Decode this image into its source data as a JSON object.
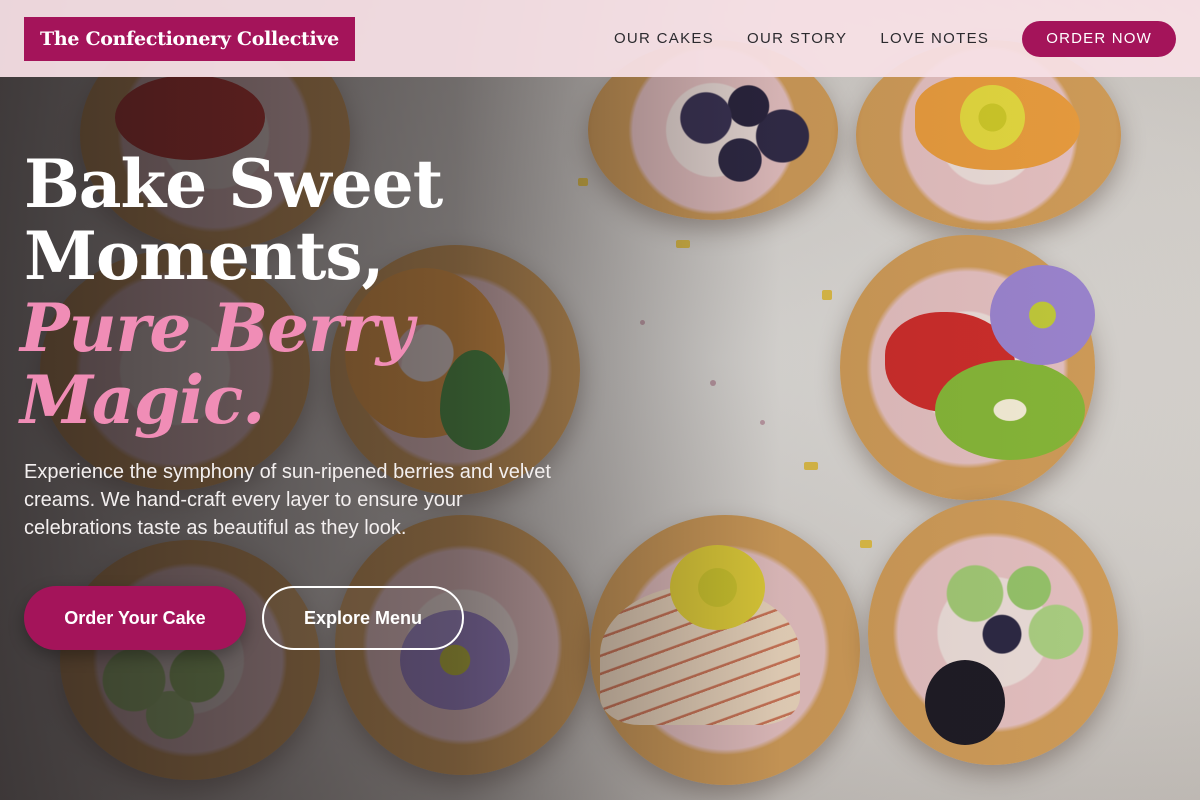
{
  "brand": {
    "name": "The Confectionery Collective"
  },
  "nav": {
    "links": [
      "OUR CAKES",
      "OUR STORY",
      "LOVE NOTES"
    ],
    "cta": "ORDER NOW"
  },
  "hero": {
    "headline_line1": "Bake Sweet",
    "headline_line2": "Moments,",
    "headline_accent1": "Pure Berry",
    "headline_accent2": "Magic.",
    "description": "Experience the symphony of sun-ripened berries and velvet creams. We hand-craft every layer to ensure your celebrations taste as beautiful as they look.",
    "primary_button": "Order Your Cake",
    "secondary_button": "Explore Menu",
    "background_image": "fruit-tarts-photo"
  },
  "colors": {
    "brand": "#a4145a",
    "accent_pink": "#f08db6",
    "header_bg": "#f6e0e6"
  }
}
